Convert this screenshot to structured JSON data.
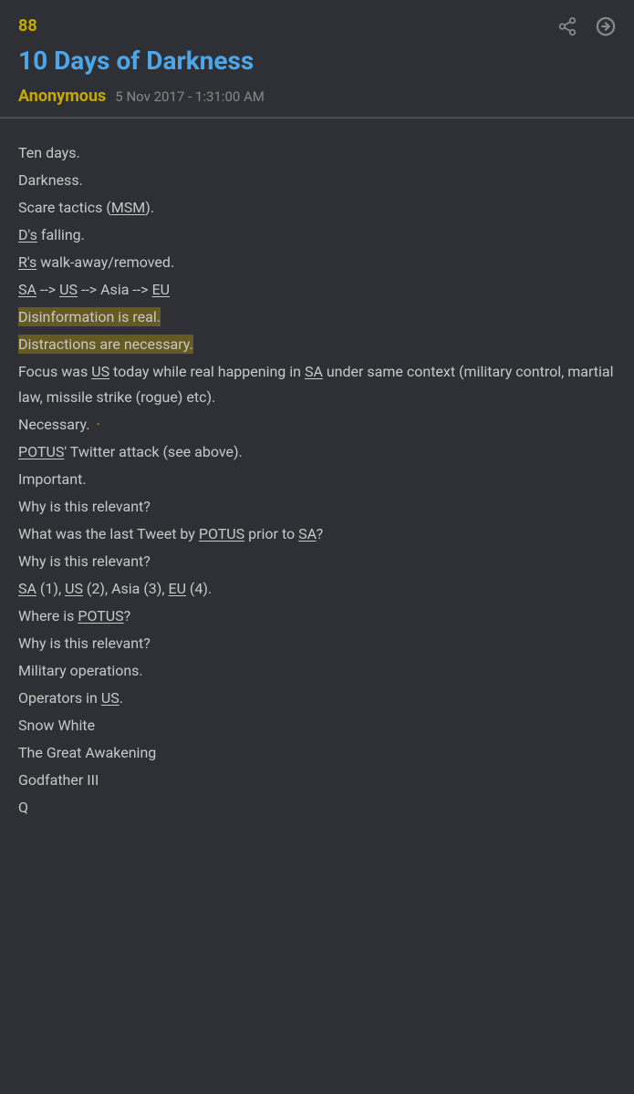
{
  "header": {
    "post_number": "88",
    "title": "10 Days of Darkness",
    "author": "Anonymous",
    "date": "5 Nov 2017 - 1:31:00 AM"
  },
  "icons": {
    "share": "⬧",
    "arrow": "→"
  },
  "content": {
    "lines": [
      {
        "id": "line1",
        "text": "Ten days.",
        "style": "plain"
      },
      {
        "id": "line2",
        "text": "Darkness.",
        "style": "plain"
      },
      {
        "id": "line3",
        "text": "Scare tactics (MSM).",
        "style": "plain",
        "underline_parts": [
          "MSM"
        ]
      },
      {
        "id": "line4",
        "text": "D's falling.",
        "style": "plain",
        "underline_parts": [
          "D's"
        ]
      },
      {
        "id": "line5",
        "text": "R's walk-away/removed.",
        "style": "plain",
        "underline_parts": [
          "R's"
        ]
      },
      {
        "id": "line6",
        "text": "SA --> US --> Asia --> EU",
        "style": "plain",
        "underline_parts": [
          "SA",
          "US",
          "EU"
        ]
      },
      {
        "id": "line7",
        "text": "Disinformation is real.",
        "style": "highlight"
      },
      {
        "id": "line8",
        "text": "Distractions are necessary.",
        "style": "highlight"
      },
      {
        "id": "line9",
        "text": "Focus was US today while real happening in SA under same context (military control, martial law, missile strike (rogue) etc).",
        "style": "plain",
        "underline_parts": [
          "US",
          "SA"
        ]
      },
      {
        "id": "line10",
        "text": "Necessary.",
        "style": "plain",
        "dot": true
      },
      {
        "id": "line11",
        "text": "POTUS' Twitter attack (see above).",
        "style": "plain",
        "underline_parts": [
          "POTUS"
        ]
      },
      {
        "id": "line12",
        "text": "Important.",
        "style": "plain"
      },
      {
        "id": "line13",
        "text": "Why is this relevant?",
        "style": "plain"
      },
      {
        "id": "line14",
        "text": "What was the last Tweet by POTUS prior to SA?",
        "style": "plain",
        "underline_parts": [
          "POTUS",
          "SA"
        ]
      },
      {
        "id": "line15",
        "text": "Why is this relevant?",
        "style": "plain"
      },
      {
        "id": "line16",
        "text": "SA (1), US (2), Asia (3), EU (4).",
        "style": "plain",
        "underline_parts": [
          "SA",
          "US",
          "EU"
        ]
      },
      {
        "id": "line17",
        "text": "Where is POTUS?",
        "style": "plain",
        "underline_parts": [
          "POTUS"
        ]
      },
      {
        "id": "line18",
        "text": "Why is this relevant?",
        "style": "plain"
      },
      {
        "id": "line19",
        "text": "Military operations.",
        "style": "plain"
      },
      {
        "id": "line20",
        "text": "Operators in US.",
        "style": "plain",
        "underline_parts": [
          "US"
        ]
      },
      {
        "id": "line21",
        "text": "Snow White",
        "style": "plain"
      },
      {
        "id": "line22",
        "text": "The Great Awakening",
        "style": "plain"
      },
      {
        "id": "line23",
        "text": "Godfather III",
        "style": "plain"
      },
      {
        "id": "line24",
        "text": "Q",
        "style": "plain"
      }
    ]
  }
}
